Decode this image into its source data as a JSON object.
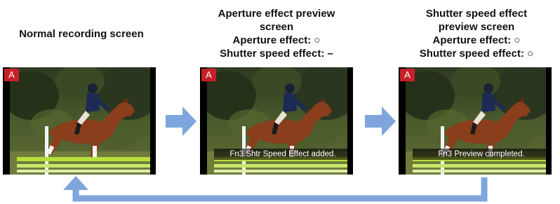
{
  "panels": [
    {
      "caption_lines": [
        "Normal recording screen"
      ],
      "mode_icon": "A",
      "message": ""
    },
    {
      "caption_lines": [
        "Aperture effect preview",
        "screen",
        "Aperture effect: ○",
        "Shutter speed effect: –"
      ],
      "mode_icon": "A",
      "message": "Fn3 Shtr Speed Effect added."
    },
    {
      "caption_lines": [
        "Shutter speed effect",
        "preview screen",
        "Aperture effect: ○",
        "Shutter speed effect: ○"
      ],
      "mode_icon": "A",
      "message": "Fn3 Preview completed."
    }
  ],
  "colors": {
    "arrow": "#7ea6dc",
    "mode_icon_bg": "#c8202a"
  },
  "icons": [
    "right-arrow-icon",
    "return-arrow-icon",
    "camera-mode-a-icon"
  ]
}
